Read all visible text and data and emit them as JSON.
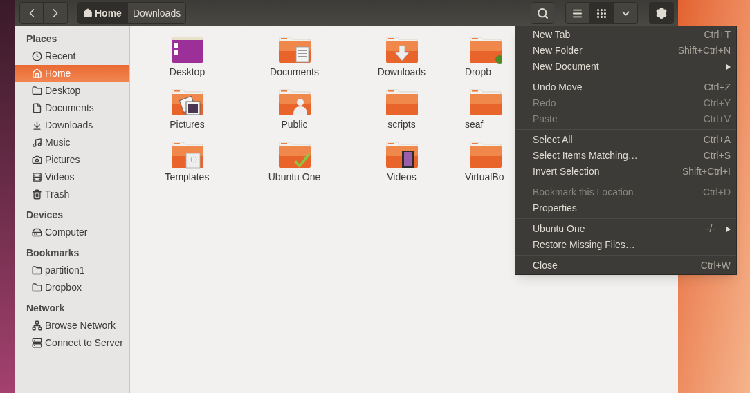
{
  "toolbar": {
    "breadcrumbs": [
      {
        "label": "Home",
        "kind": "home",
        "selected": true
      },
      {
        "label": "Downloads",
        "kind": "folder",
        "selected": false
      }
    ],
    "view_buttons": [
      {
        "kind": "list",
        "selected": false
      },
      {
        "kind": "grid",
        "selected": true
      },
      {
        "kind": "dropdown",
        "selected": false
      }
    ],
    "settings_open": true
  },
  "sidebar": {
    "sections": [
      {
        "title": "Places",
        "items": [
          {
            "label": "Recent",
            "kind": "recent",
            "selected": false
          },
          {
            "label": "Home",
            "kind": "home",
            "selected": true
          },
          {
            "label": "Desktop",
            "kind": "folder",
            "selected": false
          },
          {
            "label": "Documents",
            "kind": "document",
            "selected": false
          },
          {
            "label": "Downloads",
            "kind": "download",
            "selected": false
          },
          {
            "label": "Music",
            "kind": "music",
            "selected": false
          },
          {
            "label": "Pictures",
            "kind": "camera",
            "selected": false
          },
          {
            "label": "Videos",
            "kind": "film",
            "selected": false
          },
          {
            "label": "Trash",
            "kind": "trash",
            "selected": false
          }
        ]
      },
      {
        "title": "Devices",
        "items": [
          {
            "label": "Computer",
            "kind": "drive",
            "selected": false
          }
        ]
      },
      {
        "title": "Bookmarks",
        "items": [
          {
            "label": "partition1",
            "kind": "folder",
            "selected": false
          },
          {
            "label": "Dropbox",
            "kind": "folder",
            "selected": false
          }
        ]
      },
      {
        "title": "Network",
        "items": [
          {
            "label": "Browse Network",
            "kind": "network",
            "selected": false
          },
          {
            "label": "Connect to Server",
            "kind": "server",
            "selected": false
          }
        ]
      }
    ]
  },
  "files": [
    {
      "label": "Desktop",
      "kind": "desktop"
    },
    {
      "label": "Documents",
      "kind": "documents"
    },
    {
      "label": "Downloads",
      "kind": "downloads"
    },
    {
      "label": "Dropb",
      "kind": "synced"
    },
    {
      "label": "Pictures",
      "kind": "pictures"
    },
    {
      "label": "Public",
      "kind": "public"
    },
    {
      "label": "scripts",
      "kind": "plain"
    },
    {
      "label": "seaf",
      "kind": "plain"
    },
    {
      "label": "Templates",
      "kind": "templates"
    },
    {
      "label": "Ubuntu One",
      "kind": "check"
    },
    {
      "label": "Videos",
      "kind": "videos"
    },
    {
      "label": "VirtualBo",
      "kind": "plain"
    }
  ],
  "menu": {
    "groups": [
      [
        {
          "label": "New Tab",
          "shortcut": "Ctrl+T",
          "disabled": false,
          "submenu": false
        },
        {
          "label": "New Folder",
          "shortcut": "Shift+Ctrl+N",
          "disabled": false,
          "submenu": false
        },
        {
          "label": "New Document",
          "disabled": false,
          "submenu": true
        }
      ],
      [
        {
          "label": "Undo Move",
          "shortcut": "Ctrl+Z",
          "disabled": false,
          "submenu": false
        },
        {
          "label": "Redo",
          "shortcut": "Ctrl+Y",
          "disabled": true,
          "submenu": false
        },
        {
          "label": "Paste",
          "shortcut": "Ctrl+V",
          "disabled": true,
          "submenu": false
        }
      ],
      [
        {
          "label": "Select All",
          "shortcut": "Ctrl+A",
          "disabled": false,
          "submenu": false
        },
        {
          "label": "Select Items Matching…",
          "shortcut": "Ctrl+S",
          "disabled": false,
          "submenu": false
        },
        {
          "label": "Invert Selection",
          "shortcut": "Shift+Ctrl+I",
          "disabled": false,
          "submenu": false
        }
      ],
      [
        {
          "label": "Bookmark this Location",
          "shortcut": "Ctrl+D",
          "disabled": true,
          "submenu": false
        },
        {
          "label": "Properties",
          "disabled": false,
          "submenu": false
        }
      ],
      [
        {
          "label": "Ubuntu One",
          "shortcut": "-/-",
          "disabled": false,
          "submenu": true
        },
        {
          "label": "Restore Missing Files…",
          "disabled": false,
          "submenu": false
        }
      ],
      [
        {
          "label": "Close",
          "shortcut": "Ctrl+W",
          "disabled": false,
          "submenu": false
        }
      ]
    ]
  }
}
